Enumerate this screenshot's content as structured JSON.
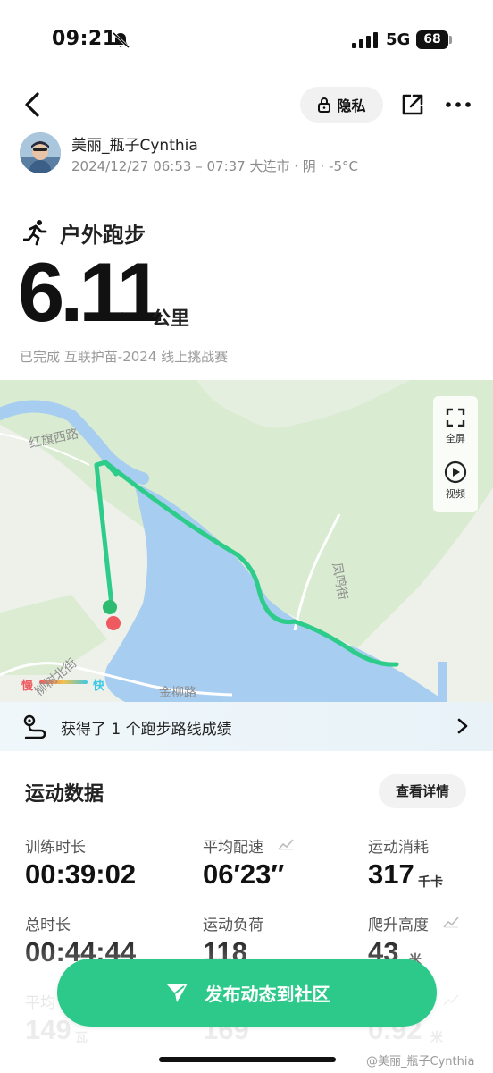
{
  "status_bar": {
    "time": "09:21",
    "network": "5G",
    "battery": "68"
  },
  "header": {
    "privacy_label": "隐私"
  },
  "user": {
    "name": "美丽_瓶子Cynthia",
    "meta": "2024/12/27 06:53 – 07:37 大连市 · 阴 · -5°C"
  },
  "activity": {
    "type": "户外跑步",
    "distance": "6.11",
    "distance_unit": "公里",
    "challenge_prefix": "已完成 ",
    "challenge_name": "互联护苗-2024 线上挑战赛"
  },
  "map": {
    "labels": {
      "road1": "红旗西路",
      "road2": "柳树北街",
      "road3": "金柳路",
      "road4": "凤鸣街"
    },
    "controls": {
      "fullscreen": "全屏",
      "video": "视频"
    },
    "legend": {
      "slow": "慢",
      "fast": "快"
    },
    "colors": {
      "route": "#2dcc8a",
      "water": "#a7cdf0",
      "land": "#edf1e9",
      "green": "#d7ebcf",
      "start": "#2dbb6f",
      "end": "#ee5a5f"
    }
  },
  "achievement": {
    "text": "获得了 1 个跑步路线成绩"
  },
  "stats": {
    "title": "运动数据",
    "details_label": "查看详情",
    "items": [
      {
        "label": "训练时长",
        "value": "00:39:02",
        "unit": ""
      },
      {
        "label": "平均配速",
        "value": "06′23″",
        "unit": ""
      },
      {
        "label": "运动消耗",
        "value": "317",
        "unit": "千卡"
      },
      {
        "label": "总时长",
        "value": "00:44:44",
        "unit": ""
      },
      {
        "label": "运动负荷",
        "value": "118",
        "unit": ""
      },
      {
        "label": "爬升高度",
        "value": "43",
        "unit": "米"
      },
      {
        "label": "平均",
        "value": "149",
        "unit": "瓦"
      },
      {
        "label": "",
        "value": "169",
        "unit": ""
      },
      {
        "label": "",
        "value": "0.92",
        "unit": "米"
      }
    ]
  },
  "publish": {
    "label": "发布动态到社区"
  },
  "watermark": "@美丽_瓶子Cynthia"
}
